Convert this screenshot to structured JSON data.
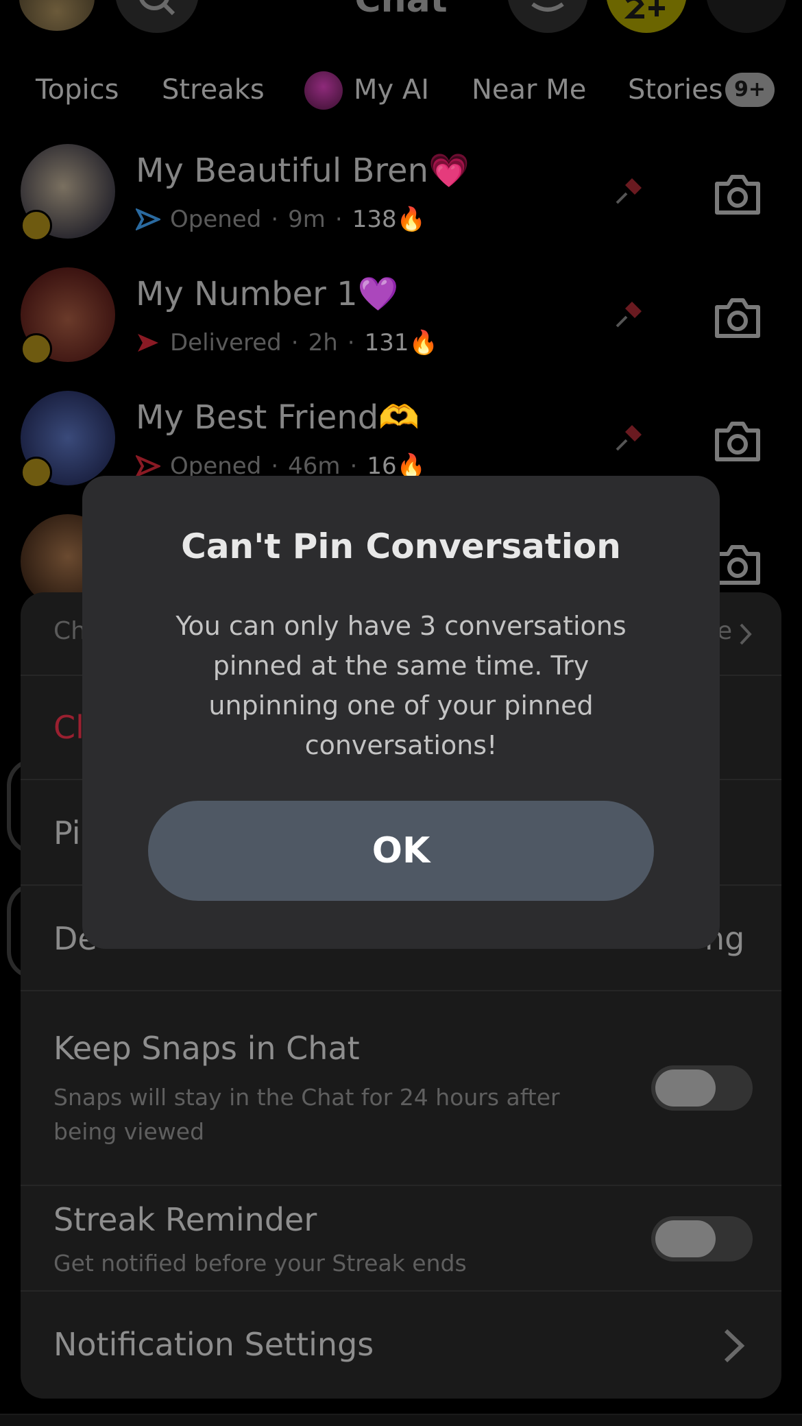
{
  "header": {
    "title": "Chat"
  },
  "tabs": [
    {
      "label": "Topics"
    },
    {
      "label": "Streaks"
    },
    {
      "label": "My AI"
    },
    {
      "label": "Near Me"
    },
    {
      "label": "Stories"
    }
  ],
  "stories_badge": "9+",
  "chats": [
    {
      "name": "My Beautiful Bren💗",
      "status": "Opened",
      "time": "9m",
      "streak": "138🔥",
      "status_color": "#3a86c8"
    },
    {
      "name": "My Number 1💜",
      "status": "Delivered",
      "time": "2h",
      "streak": "131🔥",
      "status_color": "#d8283a"
    },
    {
      "name": "My Best Friend🫶",
      "status": "Opened",
      "time": "46m",
      "streak": "16🔥",
      "status_color": "#d8283a"
    }
  ],
  "sheet": {
    "row1_left": "Ch",
    "row1_right": "e",
    "row2_left": "Cl",
    "row3_left": "Pi",
    "row4_left": "De",
    "row4_right": "ng",
    "keep_snaps": {
      "title": "Keep Snaps in Chat",
      "subtitle": "Snaps will stay in the Chat for 24 hours after being viewed"
    },
    "streak_reminder": {
      "title": "Streak Reminder",
      "subtitle": "Get notified before your Streak ends"
    },
    "notification_settings": "Notification Settings"
  },
  "modal": {
    "title": "Can't Pin Conversation",
    "body": "You can only have 3 conversations pinned at the same time. Try unpinning one of your pinned conversations!",
    "ok_label": "OK"
  }
}
